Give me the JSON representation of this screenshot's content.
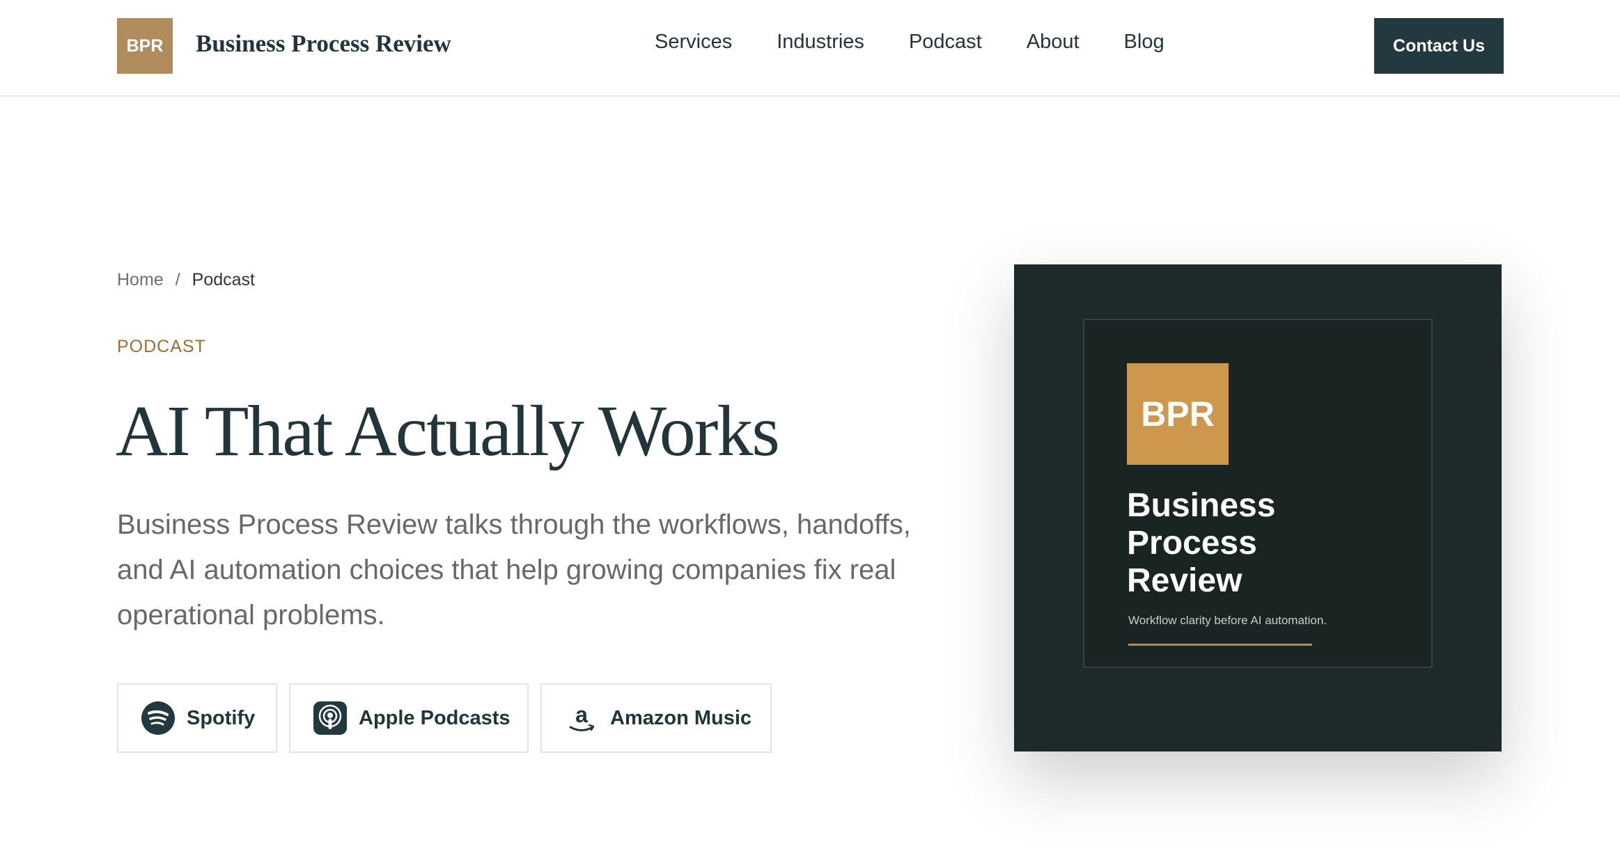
{
  "header": {
    "brand_mark": "BPR",
    "brand_name": "Business Process Review",
    "nav": [
      {
        "label": "Services"
      },
      {
        "label": "Industries"
      },
      {
        "label": "Podcast"
      },
      {
        "label": "About"
      },
      {
        "label": "Blog"
      }
    ],
    "cta_label": "Contact Us"
  },
  "breadcrumb": {
    "home": "Home",
    "separator": "/",
    "current": "Podcast"
  },
  "hero": {
    "eyebrow": "PODCAST",
    "title": "AI That Actually Works",
    "description": "Business Process Review talks through the workflows, handoffs, and AI automation choices that help growing companies fix real operational problems."
  },
  "platforms": [
    {
      "label": "Spotify",
      "icon": "spotify-icon"
    },
    {
      "label": "Apple Podcasts",
      "icon": "apple-podcasts-icon"
    },
    {
      "label": "Amazon Music",
      "icon": "amazon-music-icon"
    }
  ],
  "cover": {
    "mark": "BPR",
    "title": "Business Process Review",
    "tagline": "Workflow clarity before AI automation."
  },
  "colors": {
    "brand_gold": "#b08b5c",
    "cover_gold": "#cd984d",
    "dark_teal": "#22393f",
    "cover_bg": "#1e2a2a",
    "eyebrow": "#9a6f36"
  }
}
